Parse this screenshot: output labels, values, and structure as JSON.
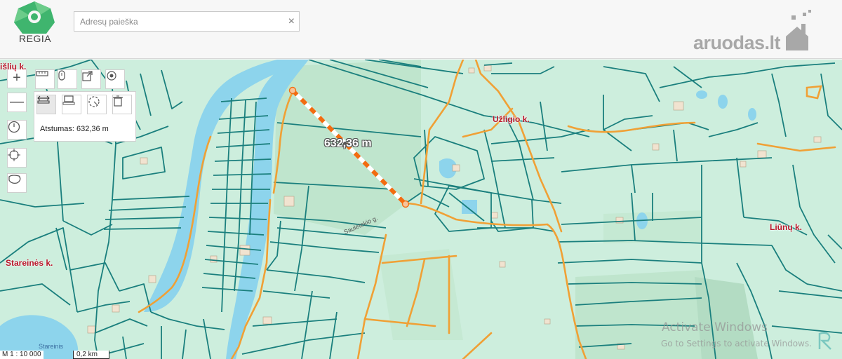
{
  "header": {
    "logo_text": "REGIA",
    "search_placeholder": "Adresų paieška",
    "clear_icon": "×",
    "brand": "aruodas",
    "brand_suffix": ".lt"
  },
  "toolbar": {
    "zoom_in": "+",
    "zoom_out": "—"
  },
  "measure": {
    "readout": "Atstumas: 632,36 m",
    "line_label": "632,36 m"
  },
  "places": {
    "uzligio": "Užligio k.",
    "staremes": "Stareinės k.",
    "liunu": "Liūnų k.",
    "lisku": "išlių k."
  },
  "roads": {
    "sauletekio": "Saulėtekio g.",
    "lake": "Stareinis"
  },
  "scale": {
    "ratio": "M 1 : 10 000",
    "distance": "0,2 km"
  },
  "watermark": {
    "line1": "Activate Windows",
    "line2": "Go to Settings to activate Windows."
  },
  "colors": {
    "accent": "#2bb3a0",
    "parcel_line": "#1a7f7d",
    "road_line": "#f0a035",
    "water": "#8dd4ec",
    "land": "#cdeedd",
    "place_text": "#b8182b"
  }
}
